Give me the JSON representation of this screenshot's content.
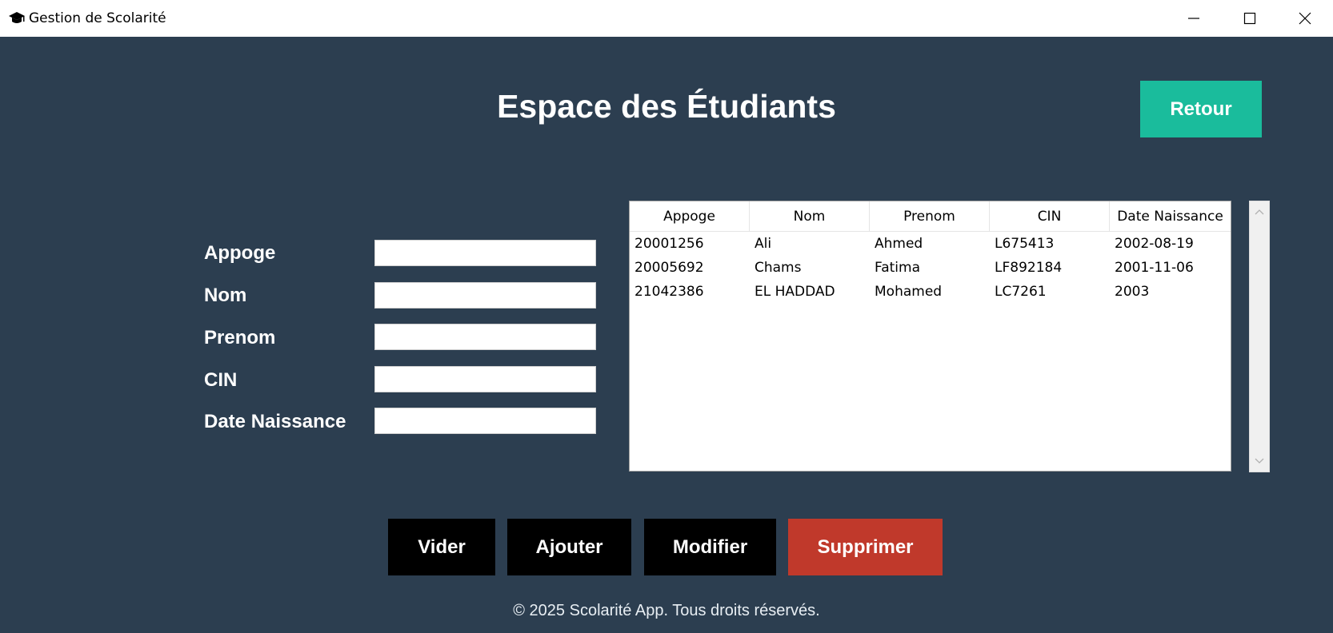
{
  "window": {
    "title": "Gestion de Scolarité",
    "icon": "graduation-cap-icon"
  },
  "header": {
    "title": "Espace des Étudiants",
    "back_label": "Retour"
  },
  "form": {
    "fields": [
      {
        "label": "Appoge",
        "value": ""
      },
      {
        "label": "Nom",
        "value": ""
      },
      {
        "label": "Prenom",
        "value": ""
      },
      {
        "label": "CIN",
        "value": ""
      },
      {
        "label": "Date Naissance",
        "value": ""
      }
    ]
  },
  "table": {
    "columns": [
      "Appoge",
      "Nom",
      "Prenom",
      "CIN",
      "Date Naissance"
    ],
    "rows": [
      [
        "20001256",
        "Ali",
        "Ahmed",
        "L675413",
        "2002-08-19"
      ],
      [
        "20005692",
        "Chams",
        "Fatima",
        "LF892184",
        "2001-11-06"
      ],
      [
        "21042386",
        "EL HADDAD",
        "Mohamed",
        "LC7261",
        "2003"
      ]
    ]
  },
  "actions": {
    "clear_label": "Vider",
    "add_label": "Ajouter",
    "edit_label": "Modifier",
    "delete_label": "Supprimer"
  },
  "footer": {
    "text": "© 2025 Scolarité App. Tous droits réservés."
  },
  "colors": {
    "background": "#2c3e50",
    "accent_teal": "#1abc9c",
    "danger_red": "#c0392b",
    "button_black": "#000000"
  }
}
